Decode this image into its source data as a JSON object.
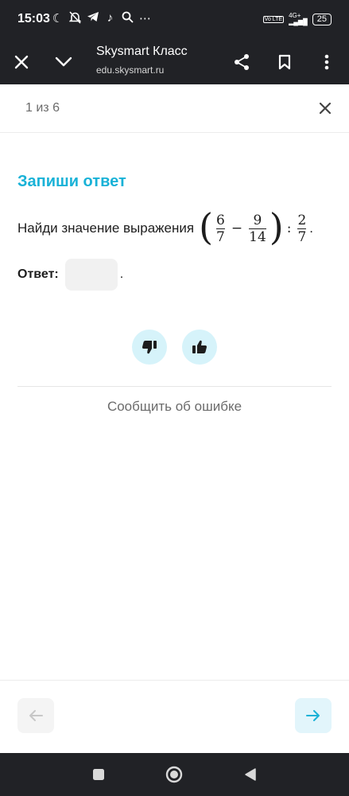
{
  "status_bar": {
    "time": "15:03",
    "icons": [
      "moon-icon",
      "bell-off-icon",
      "telegram-icon",
      "tiktok-icon",
      "search-icon",
      "more-icon"
    ],
    "network": "4G+",
    "volte": "Vo LTE",
    "battery": "25"
  },
  "browser": {
    "title": "Skysmart Класс",
    "url": "edu.skysmart.ru"
  },
  "progress": {
    "label": "1 из 6"
  },
  "task": {
    "title": "Запиши ответ",
    "prompt": "Найди значение выражения",
    "frac1_num": "6",
    "frac1_den": "7",
    "minus": "−",
    "frac2_num": "9",
    "frac2_den": "14",
    "divide": ":",
    "frac3_num": "2",
    "frac3_den": "7",
    "period": ".",
    "answer_label": "Ответ:",
    "answer_value": "",
    "answer_period": "."
  },
  "report_label": "Сообщить об ошибке",
  "colors": {
    "accent": "#19b2d7",
    "rate_bg": "#d6f3fa",
    "dark_bar": "#212226"
  }
}
